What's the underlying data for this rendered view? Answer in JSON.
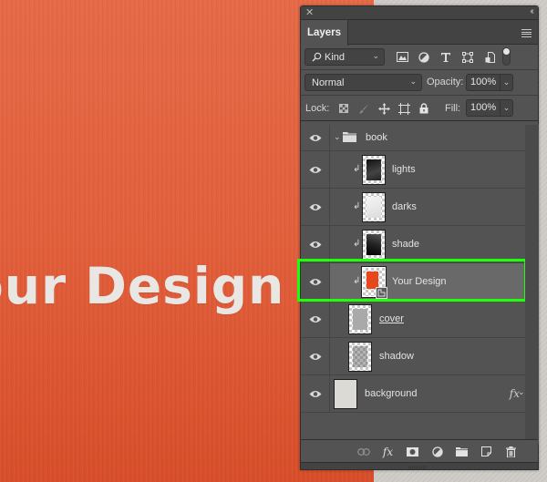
{
  "canvas": {
    "visible_text": "our Design",
    "background_color": "#e2603c",
    "text_color": "#e9e7e4"
  },
  "panel": {
    "close_icon": "close-icon",
    "collapse_icon": "double-chevron-left-icon",
    "tab_label": "Layers",
    "menu_icon": "hamburger-menu-icon",
    "filter": {
      "kind_label": "Kind",
      "icons": [
        "pixel-filter-icon",
        "adjustment-filter-icon",
        "type-filter-icon",
        "shape-filter-icon",
        "smart-object-filter-icon"
      ]
    },
    "blend_mode": "Normal",
    "opacity_label": "Opacity:",
    "opacity_value": "100%",
    "lock_label": "Lock:",
    "lock_icons": [
      "lock-transparent-icon",
      "lock-image-icon",
      "lock-position-icon",
      "lock-artboard-icon",
      "lock-all-icon"
    ],
    "fill_label": "Fill:",
    "fill_value": "100%",
    "layers": [
      {
        "name": "book",
        "type": "group",
        "visible": true,
        "expanded": true
      },
      {
        "name": "lights",
        "type": "pixel",
        "visible": true,
        "clipped": true
      },
      {
        "name": "darks",
        "type": "pixel",
        "visible": true,
        "clipped": true
      },
      {
        "name": "shade",
        "type": "pixel",
        "visible": true,
        "clipped": true
      },
      {
        "name": "Your Design",
        "type": "smart-object",
        "visible": true,
        "clipped": true,
        "selected": true
      },
      {
        "name": "cover",
        "type": "pixel",
        "visible": true,
        "clipped": false
      },
      {
        "name": "shadow",
        "type": "pixel",
        "visible": true,
        "clipped": false
      },
      {
        "name": "background",
        "type": "pixel",
        "visible": true,
        "clipped": false,
        "effects": "fx"
      }
    ],
    "footer_icons": [
      "link-layers-icon",
      "add-style-icon",
      "add-mask-icon",
      "new-adjustment-icon",
      "new-group-icon",
      "new-layer-icon",
      "delete-layer-icon"
    ],
    "accent_highlight": "#1eff0a"
  }
}
